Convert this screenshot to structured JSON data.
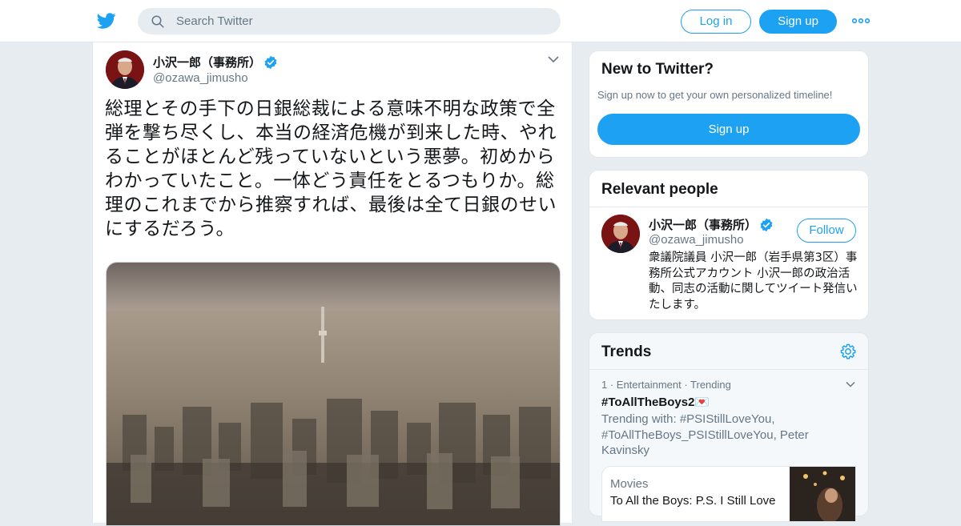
{
  "search": {
    "placeholder": "Search Twitter"
  },
  "header": {
    "login_label": "Log in",
    "signup_label": "Sign up"
  },
  "tweet": {
    "author_name": "小沢一郎（事務所）",
    "author_handle": "@ozawa_jimusho",
    "text": "総理とその手下の日銀総裁による意味不明な政策で全弾を撃ち尽くし、本当の経済危機が到来した時、やれることがほとんど残っていないという悪夢。初めからわかっていたこと。一体どう責任をとるつもりか。総理のこれまでから推察すれば、最後は全て日銀のせいにするだろう。"
  },
  "new_to_twitter": {
    "title": "New to Twitter?",
    "subtitle": "Sign up now to get your own personalized timeline!",
    "signup_label": "Sign up"
  },
  "relevant": {
    "title": "Relevant people",
    "name": "小沢一郎（事務所）",
    "handle": "@ozawa_jimusho",
    "follow_label": "Follow",
    "bio": "衆議院議員 小沢一郎（岩手県第3区）事務所公式アカウント 小沢一郎の政治活動、同志の活動に関してツイート発信いたします。"
  },
  "trends": {
    "title": "Trends",
    "item": {
      "meta": "1 · Entertainment · Trending",
      "tag": "#ToAllTheBoys2💌",
      "trending_with": "Trending with: #PSIStillLoveYou, #ToAllTheBoys_PSIStillLoveYou, Peter Kavinsky",
      "moment_category": "Movies",
      "moment_title": "To All the Boys: P.S. I Still Love"
    }
  },
  "colors": {
    "brand": "#1da1f2",
    "verified": "#1da1f2",
    "muted_text": "#657786"
  },
  "icons": [
    "twitter-bird-icon",
    "search-icon",
    "more-icon",
    "verified-icon",
    "chevron-down-icon",
    "gear-icon"
  ]
}
